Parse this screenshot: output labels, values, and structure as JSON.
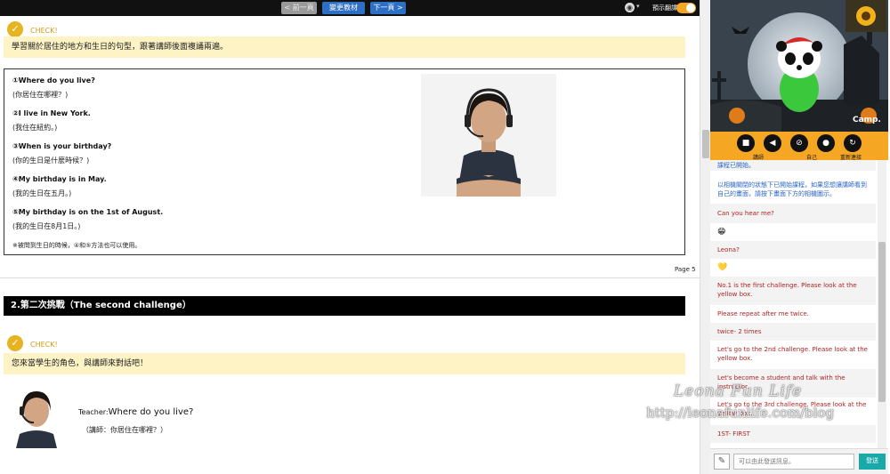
{
  "nav": {
    "prev_label": "< 前一頁",
    "change_label": "變更教材",
    "next_label": "下一頁 >",
    "translate_label": "預示翻譯"
  },
  "check1": {
    "label": "CHECK!",
    "instruction": "學習關於居住的地方和生日的句型，跟著講師後面複誦兩遍。"
  },
  "lesson": {
    "lines": [
      {
        "en": "①Where do you live?",
        "zh": "(你居住在哪裡？)"
      },
      {
        "en": "②I live in New York.",
        "zh": "(我住在紐約。)"
      },
      {
        "en": "③When is your birthday?",
        "zh": "(你的生日是什麼時候？)"
      },
      {
        "en": "④My birthday is in May.",
        "zh": "(我的生日在五月。)"
      },
      {
        "en": "⑤My birthday is on the 1st of August.",
        "zh": "(我的生日在8月1日。)"
      }
    ],
    "note": "※被問到生日的時候，④和⑤方法也可以使用。"
  },
  "page_number": "Page 5",
  "section2": {
    "header": "2.第二次挑戰（The second challenge）",
    "check_label": "CHECK!",
    "instruction": "您來當學生的角色，與講師來對話吧！",
    "teacher_prefix": "Teacher:",
    "teacher_line": "Where do you live?",
    "teacher_zh": "（講師：你居住在哪裡？）"
  },
  "video": {
    "brand": "Camp."
  },
  "controls": [
    {
      "icon": "camera-icon",
      "glyph": "■"
    },
    {
      "icon": "volume-icon",
      "glyph": "◀"
    },
    {
      "icon": "video-off-icon",
      "glyph": "⊘"
    },
    {
      "icon": "mic-icon",
      "glyph": "●"
    },
    {
      "icon": "refresh-icon",
      "glyph": "↻"
    }
  ],
  "control_labels": {
    "teacher": "講師",
    "self": "自己",
    "reconnect": "重新連接"
  },
  "chat": {
    "messages": [
      {
        "text": "課程已開始。",
        "style": "sys"
      },
      {
        "text": "以相機關閉的狀態下已開始課程，如果您想讓講師看到自己的畫面，請按下畫面下方的相機圖示。",
        "style": "sys"
      },
      {
        "text": "Can you hear me?",
        "style": "red"
      },
      {
        "text": "😁",
        "style": "emoji"
      },
      {
        "text": "Leona?",
        "style": "red"
      },
      {
        "text": "💛",
        "style": "emoji"
      },
      {
        "text": "No.1 is the first challenge. Please look at the yellow box.",
        "style": "red"
      },
      {
        "text": "Please repeat after me twice.",
        "style": "red"
      },
      {
        "text": "twice- 2 times",
        "style": "red"
      },
      {
        "text": "Let's go to the 2nd challenge. Please look at the yellow box.",
        "style": "red"
      },
      {
        "text": "Let's become a student and talk with the instructor.",
        "style": "red"
      },
      {
        "text": "Let's go to the 3rd challenge. Please look at the yellow box.",
        "style": "red"
      },
      {
        "text": "1ST- FIRST",
        "style": "red"
      }
    ],
    "input_placeholder": "可以由此發送訊息。",
    "send_label": "發送"
  },
  "watermark": {
    "line1": "Leona Fun Life",
    "line2": "http://leonafunlife.com/blog"
  }
}
